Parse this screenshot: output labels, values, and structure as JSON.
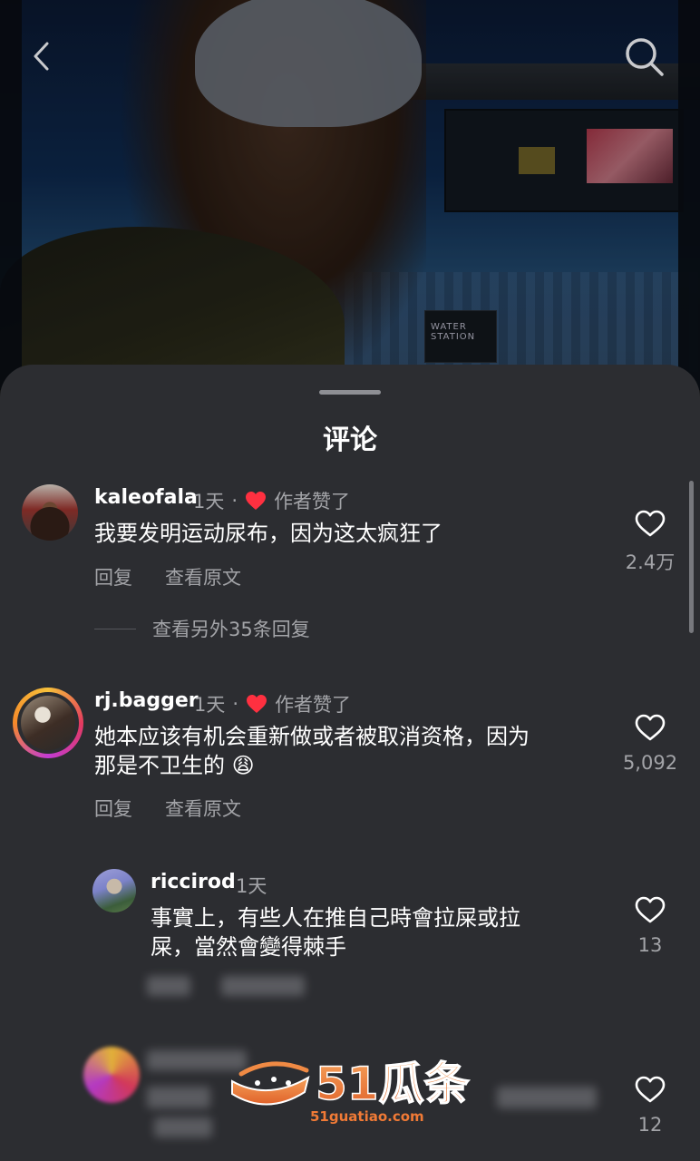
{
  "video": {
    "back_icon": "chevron-left-icon",
    "search_icon": "search-icon",
    "sign_text": "WATER STATION"
  },
  "sheet": {
    "title": "评论"
  },
  "comments": [
    {
      "username": "kaleofala",
      "time": "1天",
      "separator": "·",
      "author_liked": "作者赞了",
      "text": "我要发明运动尿布，因为这太疯狂了",
      "reply_label": "回复",
      "translate_label": "查看原文",
      "likes": "2.4万",
      "more_replies": "查看另外35条回复"
    },
    {
      "username": "rj.bagger",
      "time": "1天",
      "separator": "·",
      "author_liked": "作者赞了",
      "text": "她本应该有机会重新做或者被取消资格，因为\n那是不卫生的 😩",
      "reply_label": "回复",
      "translate_label": "查看原文",
      "likes": "5,092"
    },
    {
      "username": "riccirod",
      "time": "1天",
      "text": "事實上，有些人在推自己時會拉屎或拉\n屎，當然會變得棘手",
      "likes": "13"
    },
    {
      "likes": "12"
    }
  ],
  "watermark": {
    "brand": "51瓜条",
    "url": "51guatiao.com"
  },
  "colors": {
    "sheet_bg": "#2c2d31",
    "heart_red": "#ff3040",
    "muted_text": "#a3a4a8"
  }
}
